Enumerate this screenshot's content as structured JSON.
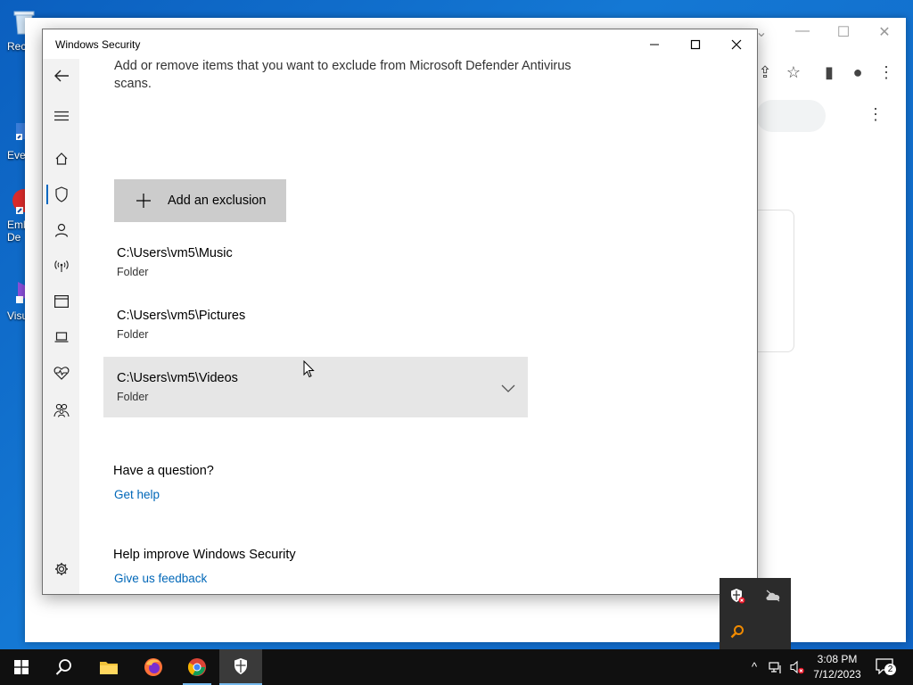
{
  "desktop": {
    "icons": [
      {
        "label": "Rec",
        "icon": "recycle-bin-icon"
      },
      {
        "label": "Eve",
        "icon": "shortcut-icon"
      },
      {
        "label": "Emb",
        "label2": "De",
        "icon": "app-shortcut-icon"
      },
      {
        "label": "Visu",
        "icon": "visual-studio-shortcut-icon"
      }
    ]
  },
  "window": {
    "title": "Windows Security",
    "controls": {
      "minimize": "minimize-icon",
      "maximize": "maximize-icon",
      "close": "close-icon"
    }
  },
  "sidebar": {
    "items": [
      {
        "name": "back",
        "icon": "back-arrow-icon"
      },
      {
        "name": "menu",
        "icon": "hamburger-menu-icon"
      },
      {
        "name": "home",
        "icon": "home-icon"
      },
      {
        "name": "virus-protection",
        "icon": "shield-icon",
        "active": true
      },
      {
        "name": "account-protection",
        "icon": "person-icon"
      },
      {
        "name": "firewall",
        "icon": "network-antenna-icon"
      },
      {
        "name": "app-browser-control",
        "icon": "browser-window-icon"
      },
      {
        "name": "device-security",
        "icon": "laptop-icon"
      },
      {
        "name": "device-performance",
        "icon": "heart-pulse-icon"
      },
      {
        "name": "family-options",
        "icon": "family-icon"
      },
      {
        "name": "settings",
        "icon": "gear-icon"
      }
    ]
  },
  "main": {
    "intro": "Add or remove items that you want to exclude from Microsoft Defender Antivirus scans.",
    "add_button_label": "Add an exclusion",
    "exclusions": [
      {
        "path": "C:\\Users\\vm5\\Music",
        "type": "Folder"
      },
      {
        "path": "C:\\Users\\vm5\\Pictures",
        "type": "Folder"
      },
      {
        "path": "C:\\Users\\vm5\\Videos",
        "type": "Folder",
        "hovered": true
      }
    ],
    "help_heading": "Have a question?",
    "help_link": "Get help",
    "improve_heading": "Help improve Windows Security",
    "feedback_link": "Give us feedback"
  },
  "tray_popup": {
    "icons": [
      "windows-security-warning-icon",
      "onedrive-off-icon",
      "search-magnifier-icon"
    ]
  },
  "taskbar": {
    "items": [
      "start-icon",
      "search-icon",
      "file-explorer-icon",
      "firefox-icon",
      "chrome-icon",
      "windows-security-icon"
    ],
    "time": "3:08 PM",
    "date": "7/12/2023",
    "notification_count": "2"
  },
  "colors": {
    "accent": "#0067c0",
    "link": "#0067b8",
    "button_bg": "#cccccc",
    "hover_bg": "#e6e6e6"
  }
}
